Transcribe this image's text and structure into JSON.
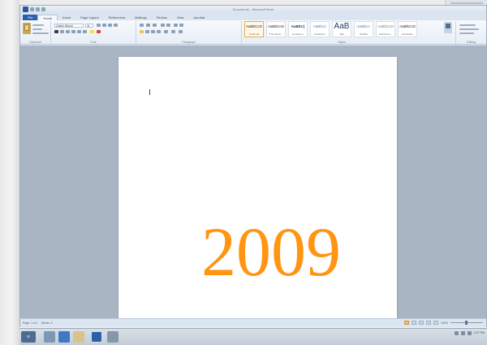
{
  "window": {
    "title": "Document1 - Microsoft Word"
  },
  "tabs": [
    {
      "label": "File"
    },
    {
      "label": "Home"
    },
    {
      "label": "Insert"
    },
    {
      "label": "Page Layout"
    },
    {
      "label": "References"
    },
    {
      "label": "Mailings"
    },
    {
      "label": "Review"
    },
    {
      "label": "View"
    },
    {
      "label": "Acrobat"
    }
  ],
  "ribbon": {
    "clipboard": {
      "label": "Clipboard",
      "paste": "Paste",
      "cut": "Cut",
      "copy": "Copy",
      "format_painter": "Format Painter"
    },
    "font": {
      "label": "Font",
      "font_name": "Calibri (Body)",
      "font_size": "11"
    },
    "paragraph": {
      "label": "Paragraph"
    },
    "styles": {
      "label": "Styles",
      "tiles": [
        {
          "sample": "AaBbCcDc",
          "name": "¶ Normal"
        },
        {
          "sample": "AaBbCcDc",
          "name": "¶ No Spaci..."
        },
        {
          "sample": "AaBbC(",
          "name": "Heading 1"
        },
        {
          "sample": "AaBbCc",
          "name": "Heading 2"
        },
        {
          "sample": "AaB",
          "name": "Title"
        },
        {
          "sample": "AaBbCc.",
          "name": "Subtitle"
        },
        {
          "sample": "AaBbCcDc",
          "name": "Subtle Em..."
        },
        {
          "sample": "AaBbCcDc",
          "name": "Emphasis"
        }
      ],
      "change_styles": "Change Styles"
    },
    "editing": {
      "label": "Editing",
      "find": "Find",
      "replace": "Replace",
      "select": "Select"
    }
  },
  "document": {
    "year_text": "2009",
    "year_color": "#ff9512"
  },
  "statusbar": {
    "page": "Page: 1 of 1",
    "words": "Words: 0",
    "zoom": "100%"
  },
  "taskbar": {
    "start_label": "Start",
    "clock_time": "2:07 PM"
  },
  "icons": {
    "start": "windows-logo-icon",
    "paste": "clipboard-icon",
    "cursor": "text-cursor-icon"
  }
}
